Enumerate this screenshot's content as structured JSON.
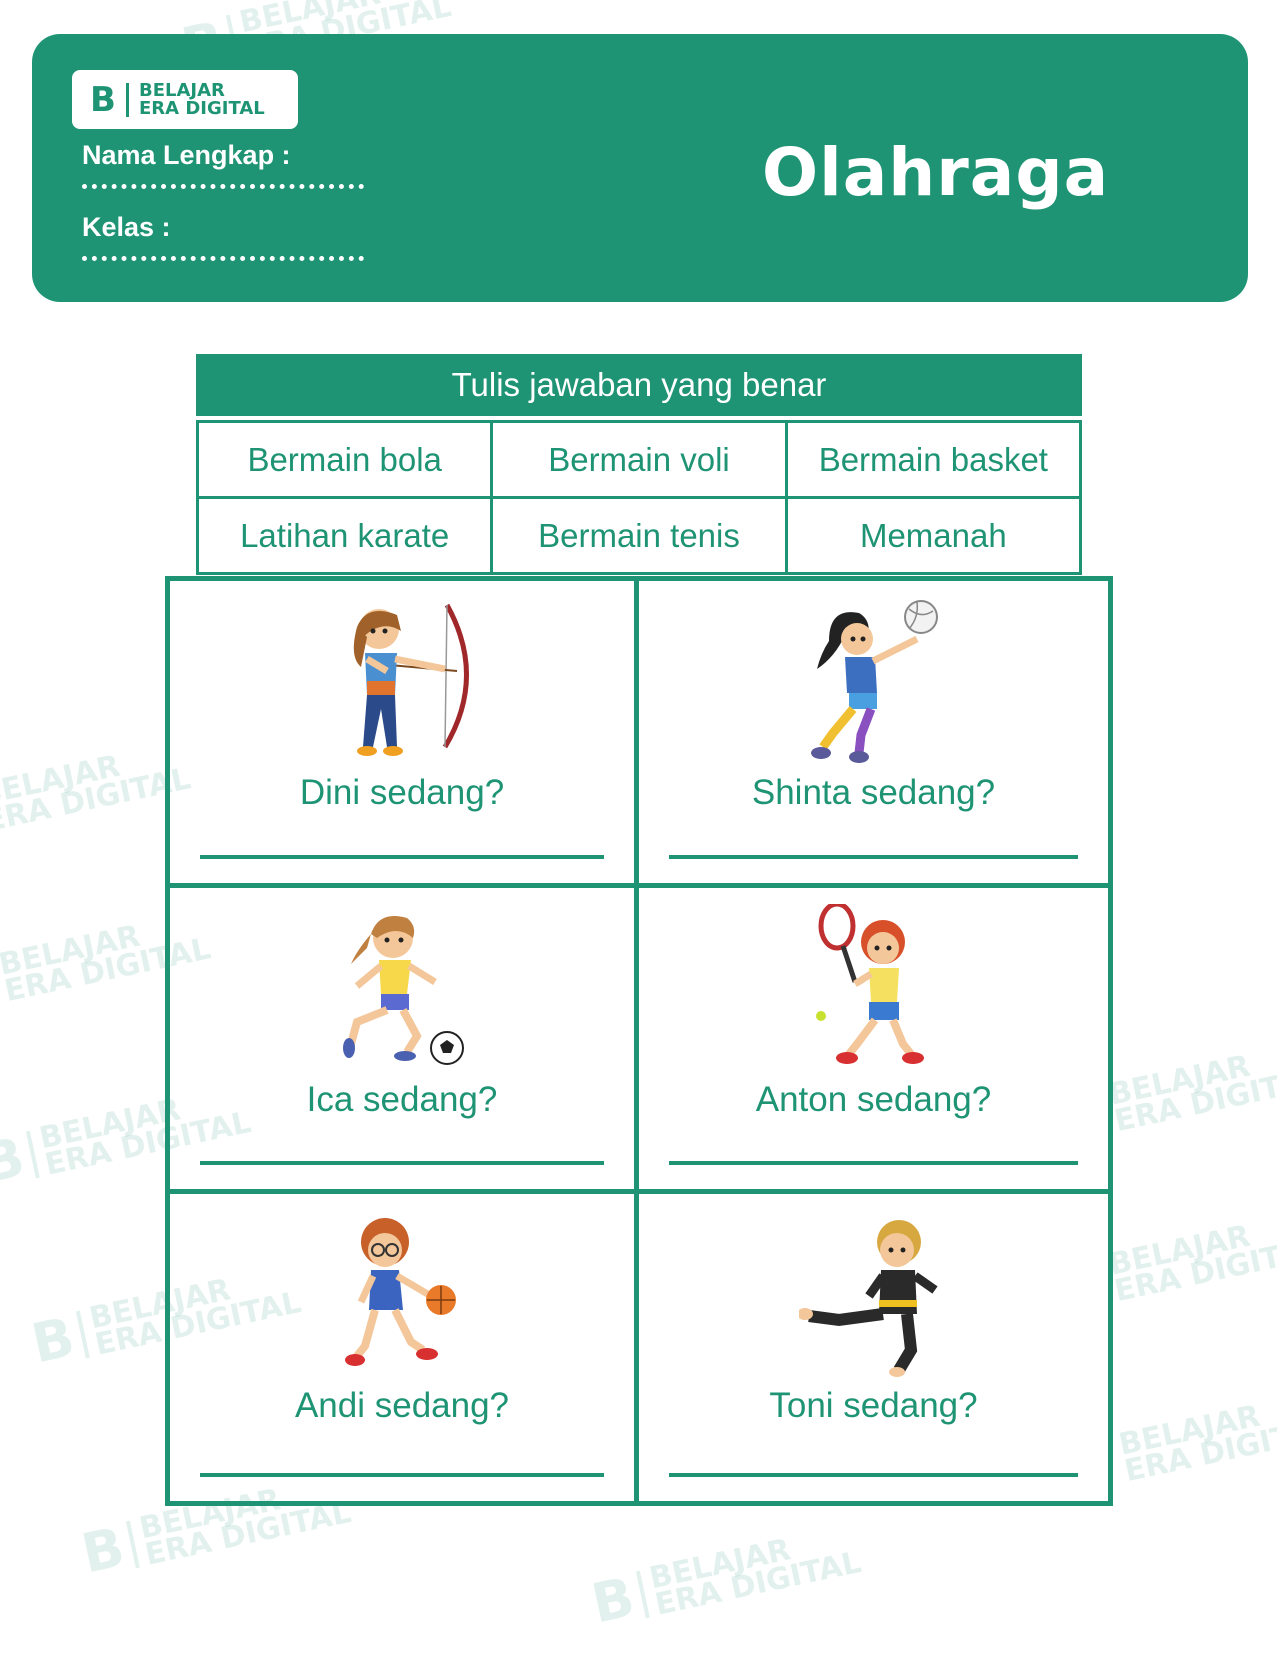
{
  "colors": {
    "brand": "#1e9474",
    "text_on_brand": "#ffffff"
  },
  "watermark": {
    "brand_mark": "B",
    "line1": "BELAJAR",
    "line2": "ERA DIGITAL"
  },
  "header": {
    "logo": {
      "mark": "B",
      "line1": "BELAJAR",
      "line2": "ERA DIGITAL"
    },
    "name_label": "Nama Lengkap :",
    "class_label": "Kelas :",
    "title": "Olahraga"
  },
  "word_bank": {
    "heading": "Tulis jawaban yang benar",
    "options": [
      "Bermain bola",
      "Bermain voli",
      "Bermain basket",
      "Latihan karate",
      "Bermain tenis",
      "Memanah"
    ]
  },
  "questions": [
    {
      "text": "Dini sedang?",
      "picture": "archery-girl"
    },
    {
      "text": "Shinta sedang?",
      "picture": "volleyball-girl"
    },
    {
      "text": "Ica sedang?",
      "picture": "soccer-girl"
    },
    {
      "text": "Anton sedang?",
      "picture": "tennis-boy"
    },
    {
      "text": "Andi sedang?",
      "picture": "basketball-boy"
    },
    {
      "text": "Toni sedang?",
      "picture": "karate-boy"
    }
  ]
}
